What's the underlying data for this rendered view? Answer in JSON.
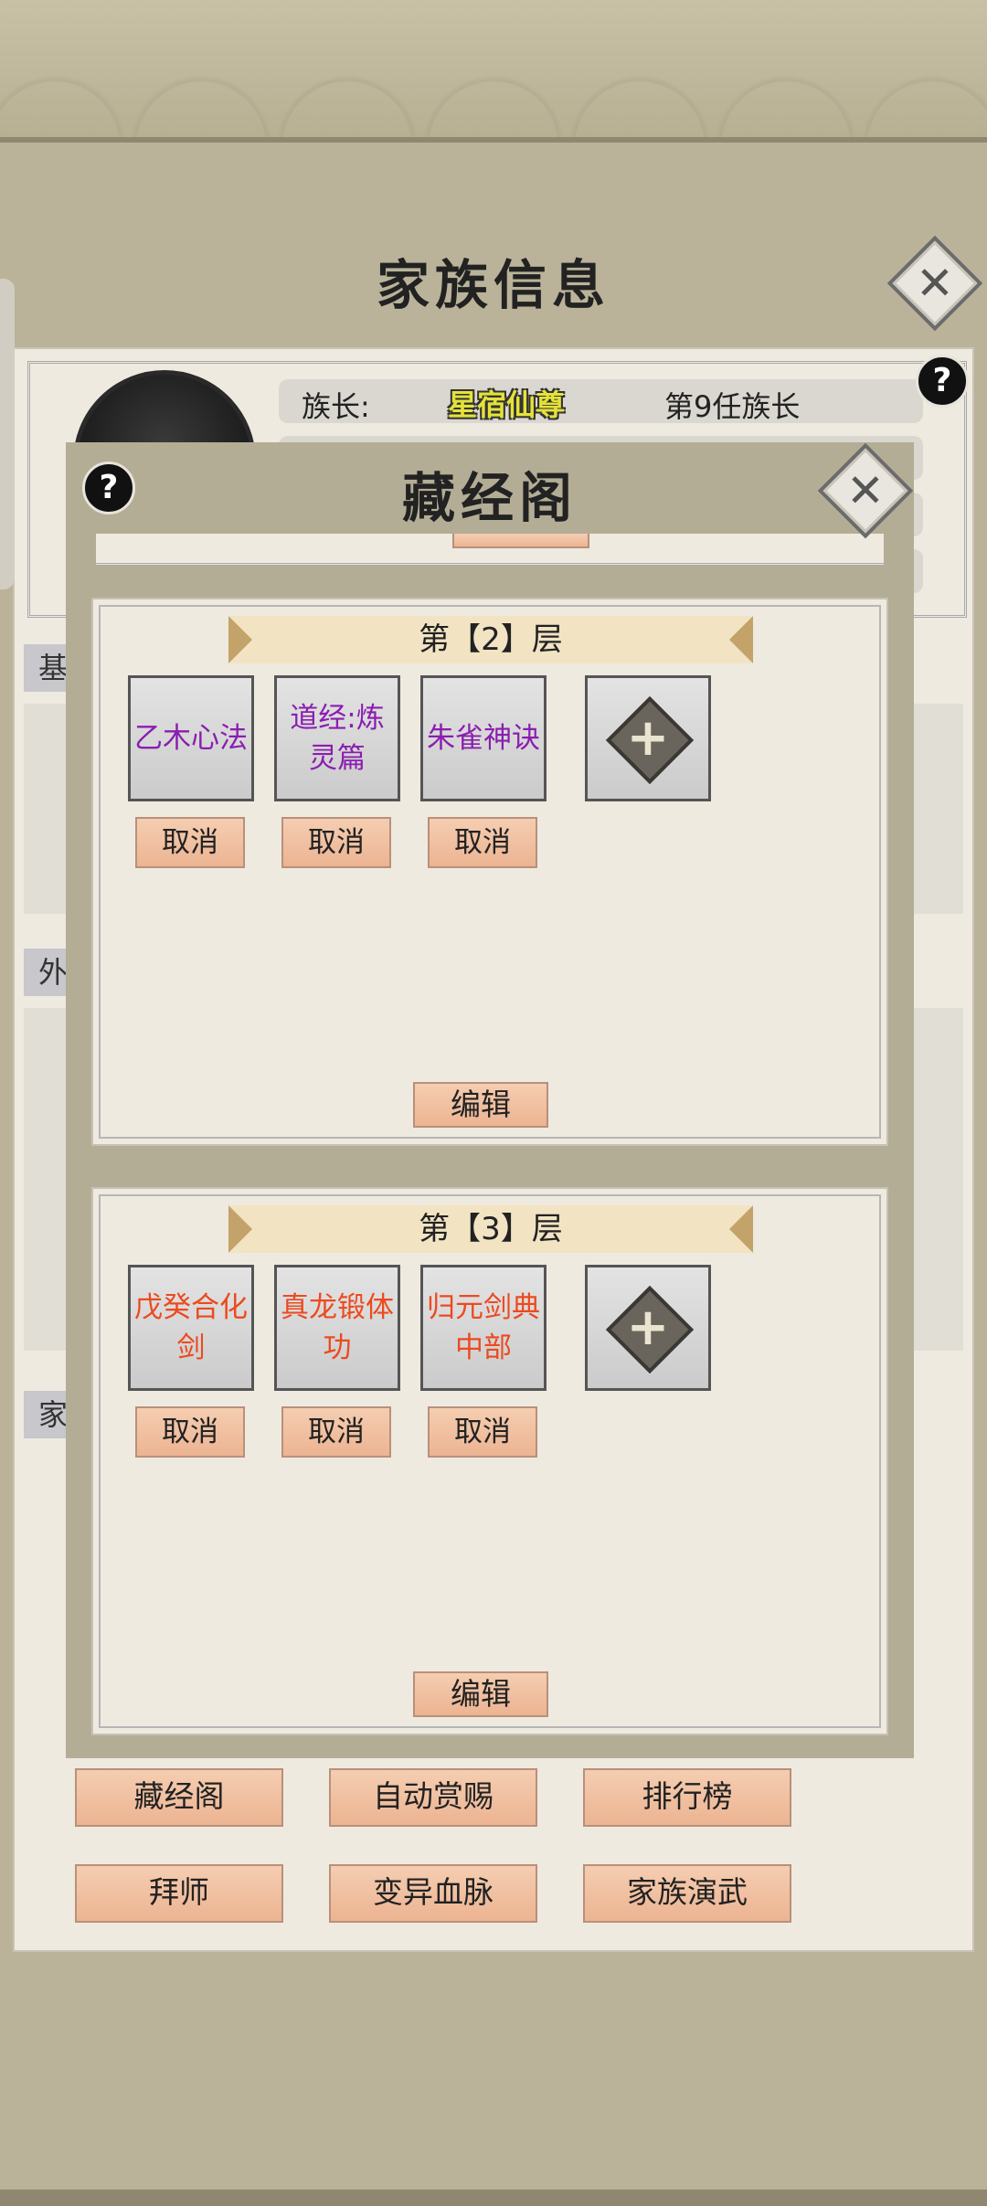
{
  "family": {
    "title": "家族信息",
    "leader_label": "族长:",
    "leader_name": "星宿仙尊",
    "leader_rank": "第9任族长",
    "section_labels": [
      "基",
      "外",
      "家"
    ]
  },
  "library": {
    "title": "藏经阁",
    "floors": [
      {
        "banner": "第【2】层",
        "techniques": [
          {
            "name": "乙木心法",
            "color": "#8a1eb0"
          },
          {
            "name": "道经:炼灵篇",
            "color": "#8a1eb0"
          },
          {
            "name": "朱雀神诀",
            "color": "#8a1eb0"
          }
        ],
        "cancel_label": "取消",
        "edit_label": "编辑"
      },
      {
        "banner": "第【3】层",
        "techniques": [
          {
            "name": "戊癸合化剑",
            "color": "#ec4a20"
          },
          {
            "name": "真龙锻体功",
            "color": "#ec4a20"
          },
          {
            "name": "归元剑典中部",
            "color": "#ec4a20"
          }
        ],
        "cancel_label": "取消",
        "edit_label": "编辑"
      }
    ]
  },
  "nav": {
    "buttons": [
      "藏经阁",
      "自动赏赐",
      "排行榜",
      "拜师",
      "变异血脉",
      "家族演武"
    ]
  },
  "icons": {
    "help": "?",
    "close": "✕",
    "add": "+"
  }
}
